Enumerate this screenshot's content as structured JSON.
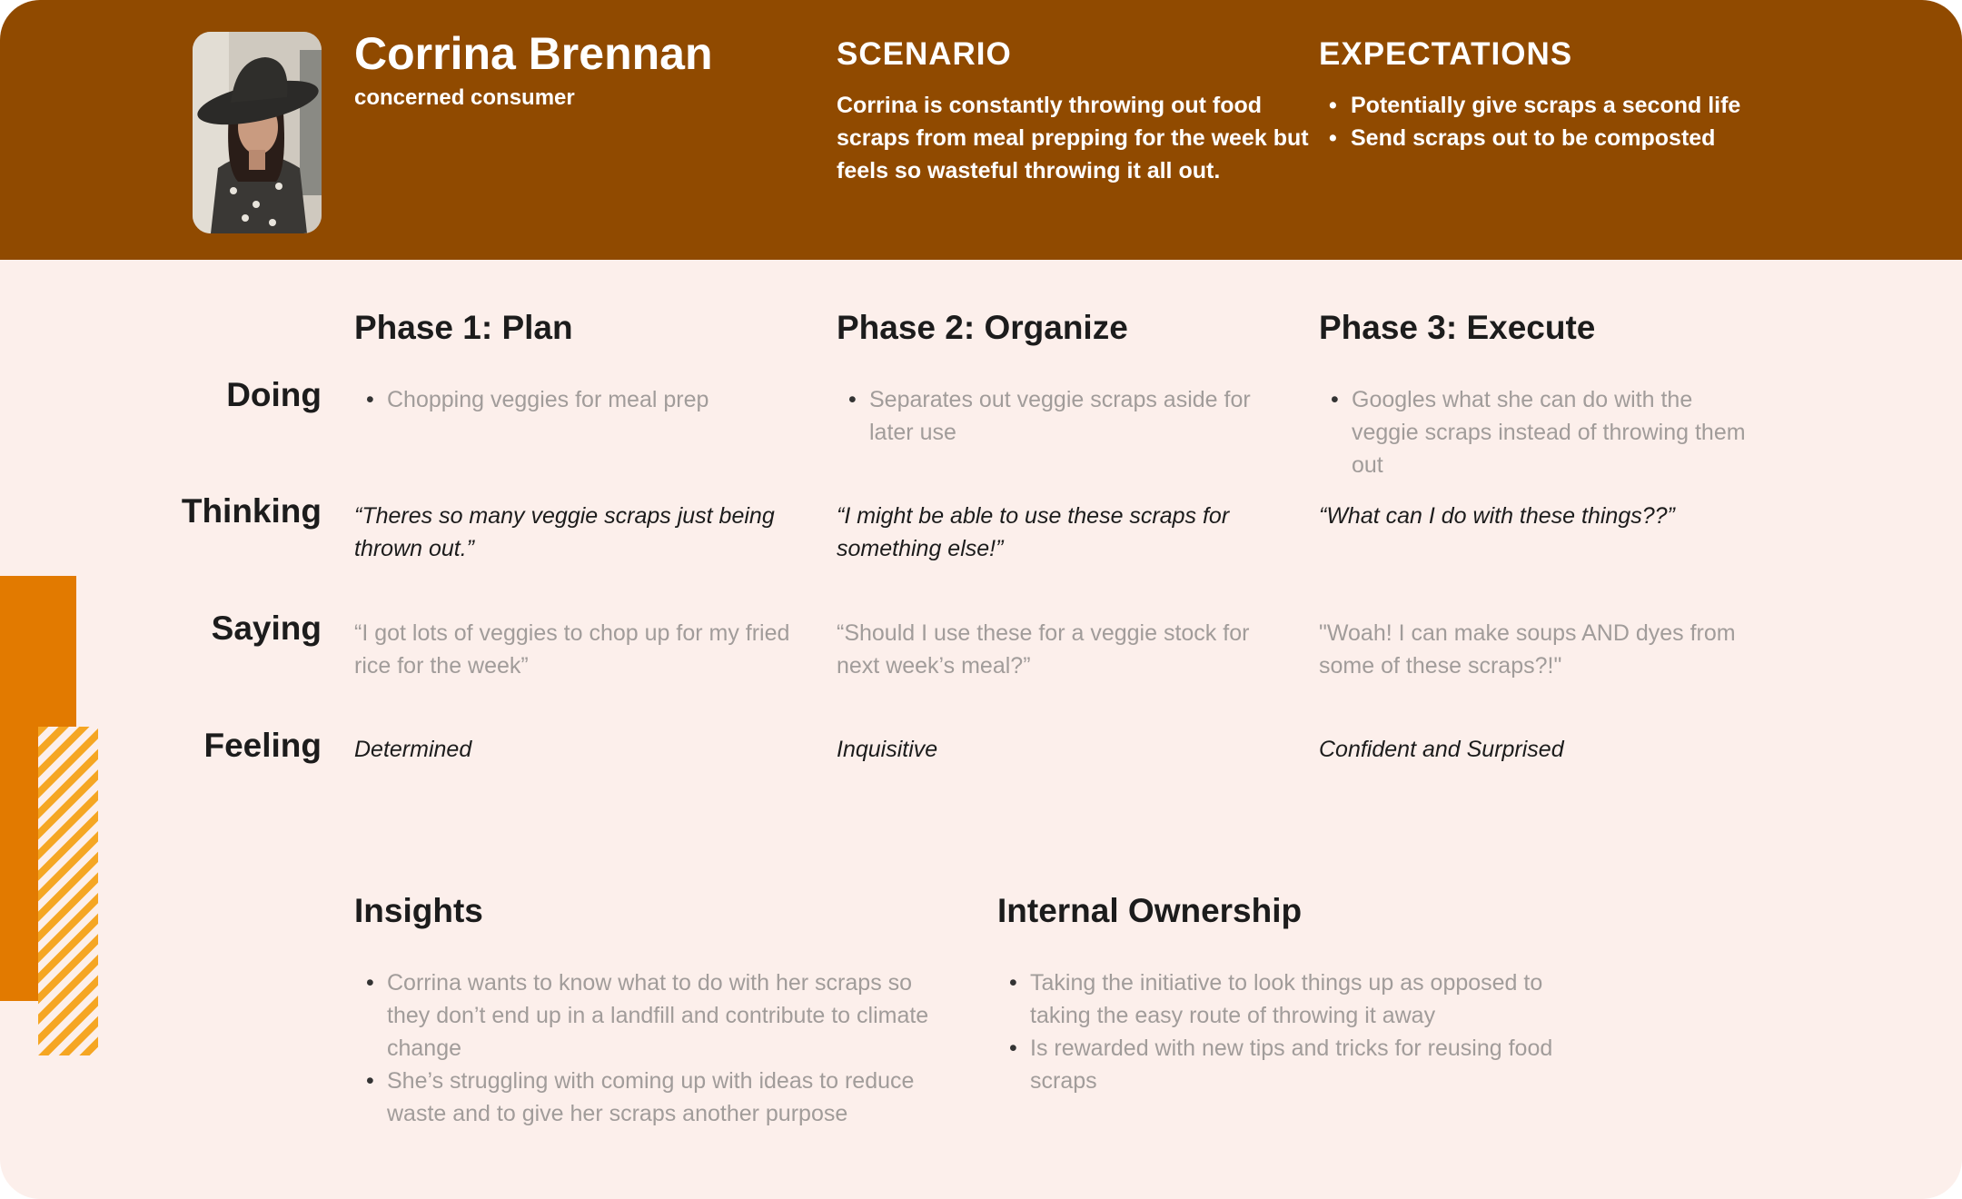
{
  "persona": {
    "name": "Corrina Brennan",
    "role": "concerned consumer",
    "photo_icon": "persona-photo"
  },
  "scenario": {
    "heading": "SCENARIO",
    "text": "Corrina is constantly throwing out food scraps from meal prepping for the week but feels so wasteful throwing it all out."
  },
  "expectations": {
    "heading": "EXPECTATIONS",
    "items": [
      "Potentially give scraps a second life",
      "Send scraps out to be composted"
    ]
  },
  "phases": [
    {
      "title": "Phase 1: Plan",
      "doing": "Chopping veggies for meal prep",
      "thinking": "“Theres so many veggie scraps just being thrown out.”",
      "saying": "“I got lots of veggies to chop up for my fried rice for the week”",
      "feeling": "Determined"
    },
    {
      "title": "Phase 2: Organize",
      "doing": "Separates out veggie scraps aside for later use",
      "thinking": "“I might be able to use these scraps for something else!”",
      "saying": "“Should I use these for a veggie stock for next week’s meal?”",
      "feeling": "Inquisitive"
    },
    {
      "title": "Phase 3: Execute",
      "doing": "Googles what she can do with the veggie scraps instead of throwing them out",
      "thinking": "“What can I do with these things??”",
      "saying": "\"Woah! I can make soups AND dyes from some of these scraps?!\"",
      "feeling": "Confident and Surprised"
    }
  ],
  "rows": {
    "doing": "Doing",
    "thinking": "Thinking",
    "saying": "Saying",
    "feeling": "Feeling"
  },
  "insights": {
    "title": "Insights",
    "items": [
      "Corrina wants to know what to do with her scraps so they don’t end up in a landfill and contribute to climate change",
      "She’s struggling with coming up with ideas to reduce waste and to give her scraps another purpose"
    ]
  },
  "ownership": {
    "title": "Internal Ownership",
    "items": [
      "Taking the initiative to look things up as opposed to taking the easy route of throwing it away",
      "Is rewarded with new tips and tricks for reusing food scraps"
    ]
  },
  "colors": {
    "header": "#904a00",
    "background": "#fcefeb",
    "accent": "#e27a00",
    "stripes": "#f5a623"
  }
}
